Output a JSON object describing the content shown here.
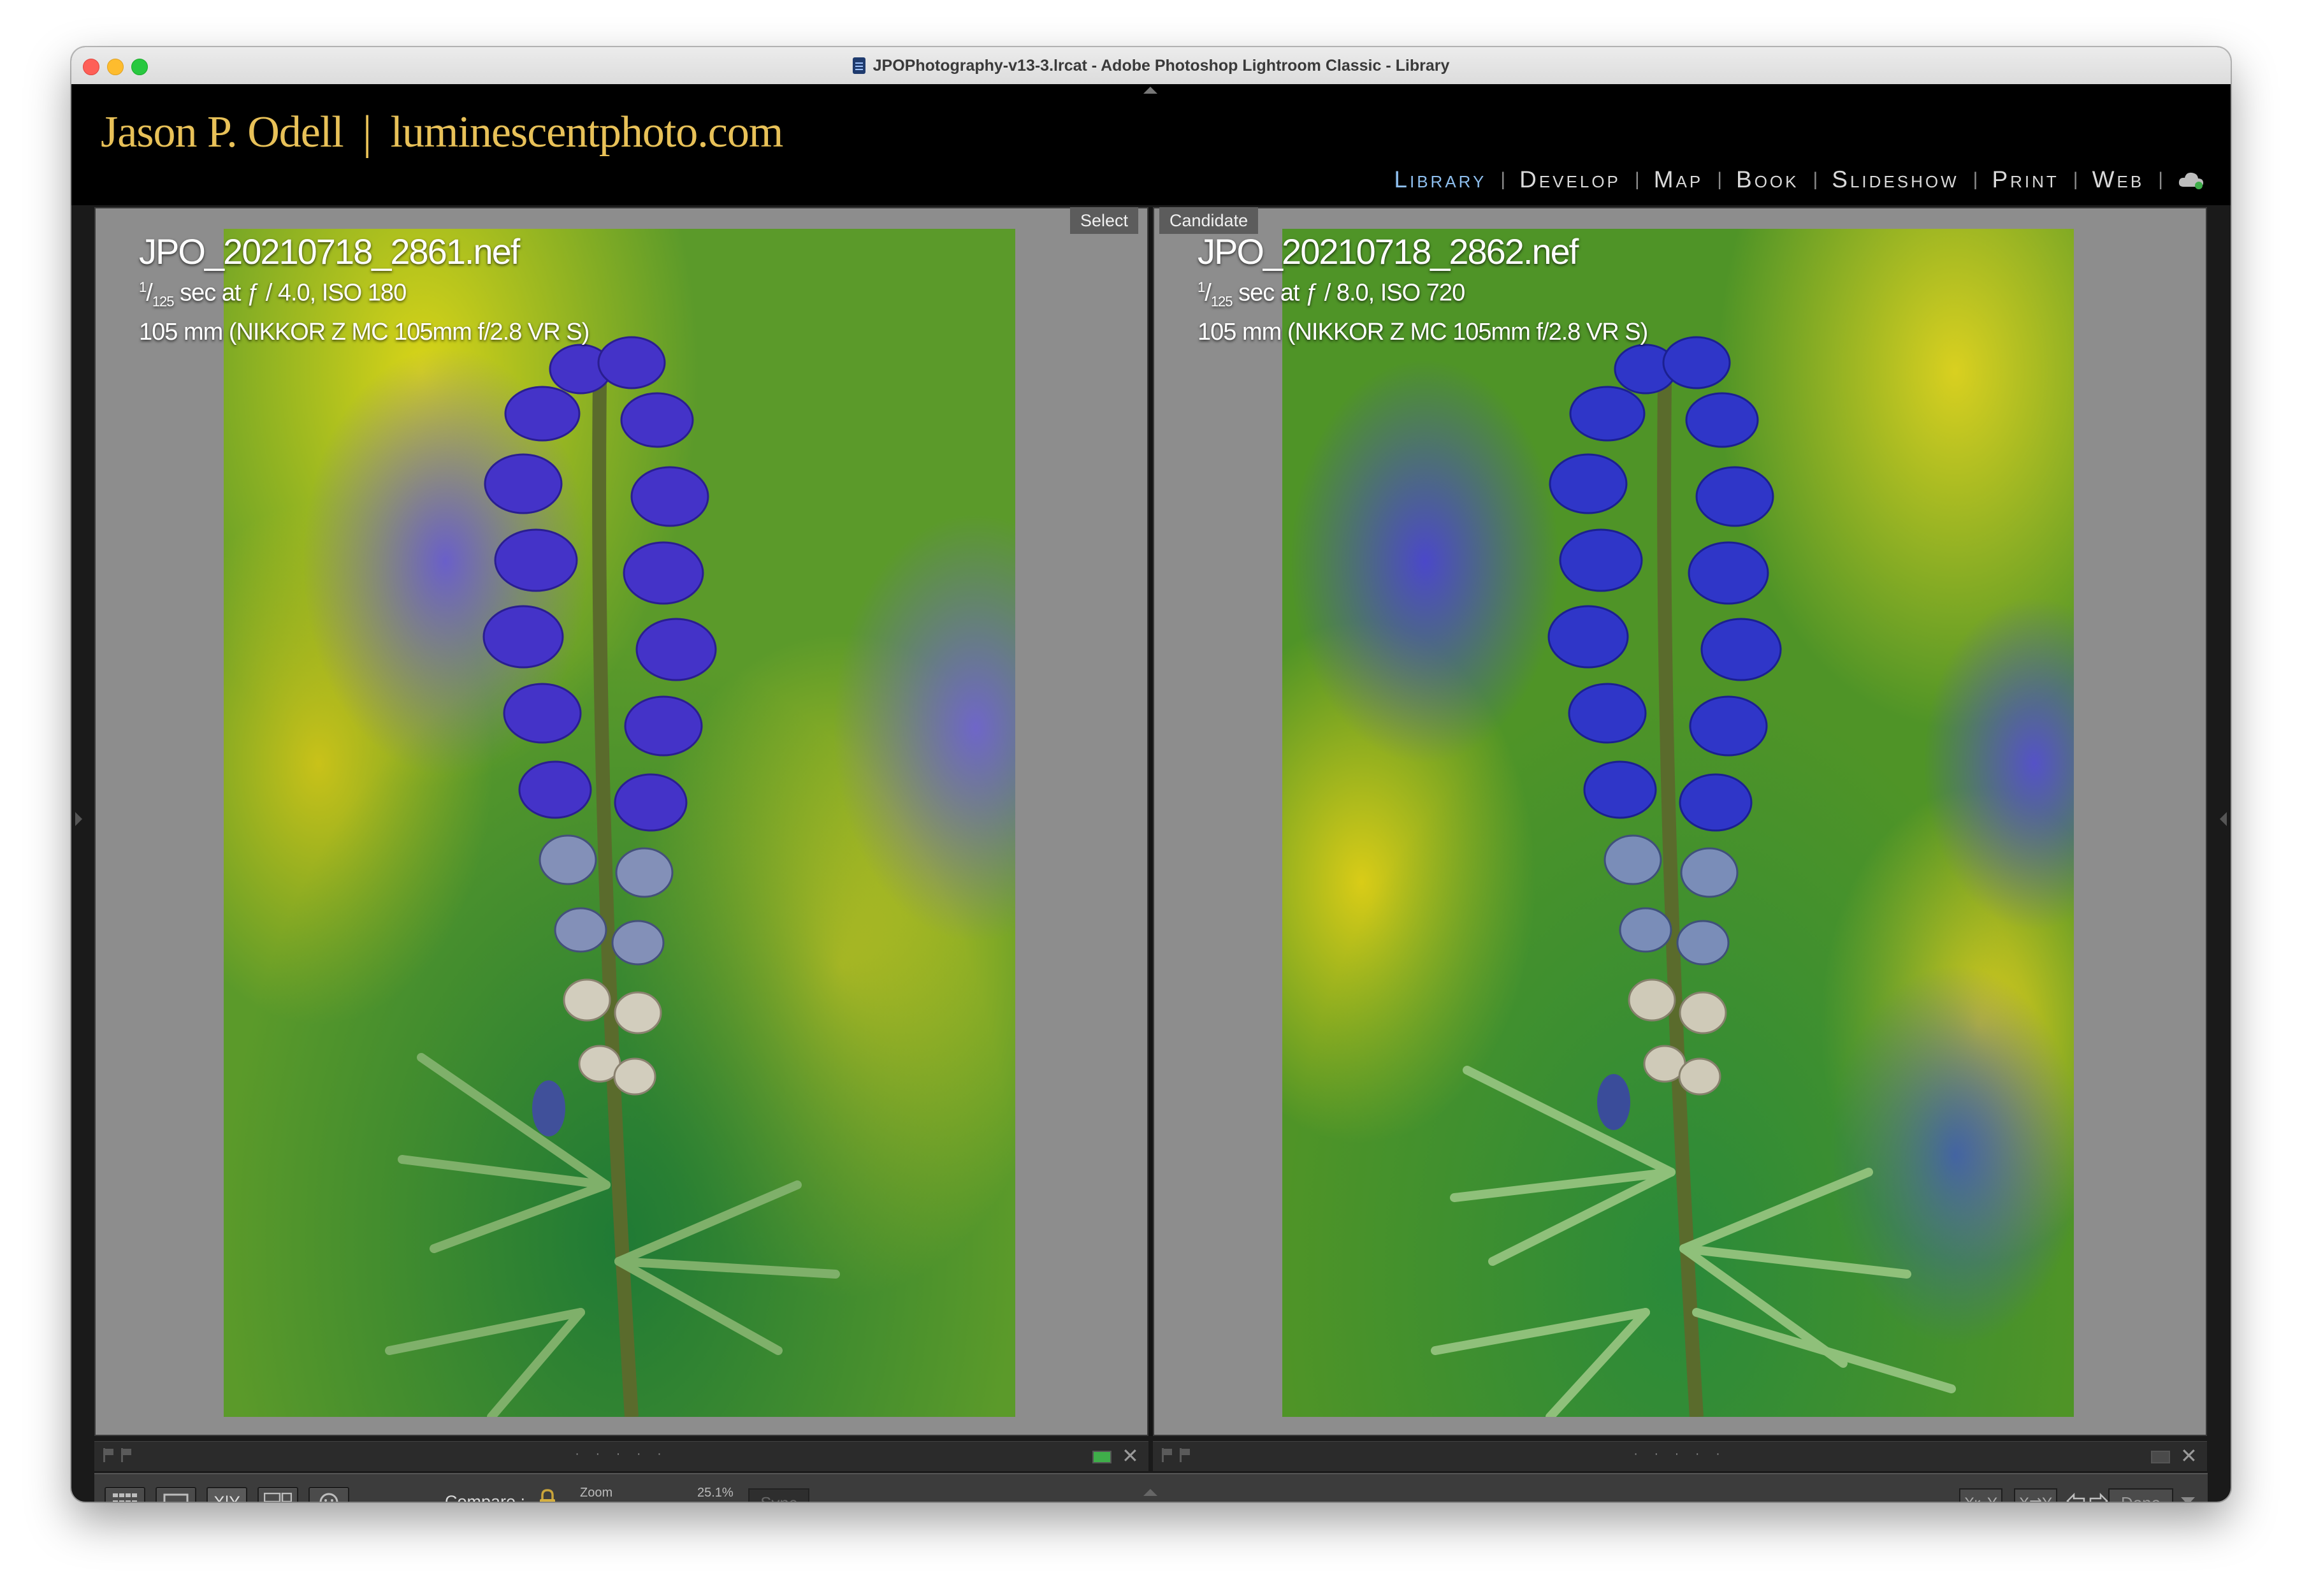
{
  "window": {
    "title": "JPOPhotography-v13-3.lrcat - Adobe Photoshop Lightroom Classic - Library"
  },
  "identity_plate": {
    "name": "Jason P. Odell",
    "separator": "|",
    "website": "luminescentphoto.com"
  },
  "modules": [
    {
      "label": "Library",
      "active": true
    },
    {
      "label": "Develop",
      "active": false
    },
    {
      "label": "Map",
      "active": false
    },
    {
      "label": "Book",
      "active": false
    },
    {
      "label": "Slideshow",
      "active": false
    },
    {
      "label": "Print",
      "active": false
    },
    {
      "label": "Web",
      "active": false
    }
  ],
  "module_separator": "|",
  "compare": {
    "select": {
      "tag": "Select",
      "filename": "JPO_20210718_2861.nef",
      "shutter_num": "1",
      "shutter_den": "125",
      "exposure_rest": "sec at ƒ / 4.0, ISO 180",
      "lens": "105 mm (NIKKOR Z MC 105mm f/2.8 VR S)"
    },
    "candidate": {
      "tag": "Candidate",
      "filename": "JPO_20210718_2862.nef",
      "shutter_num": "1",
      "shutter_den": "125",
      "exposure_rest": "sec at ƒ / 8.0, ISO 720",
      "lens": "105 mm (NIKKOR Z MC 105mm f/2.8 VR S)"
    }
  },
  "pane_footer": {
    "dots": "· · · · ·",
    "close": "✕"
  },
  "toolbar": {
    "compare_label": "Compare :",
    "zoom_label": "Zoom",
    "zoom_value": "25.1%",
    "zoom_level": 0.08,
    "sync_label": "Sync",
    "xy_label": "X|Y",
    "swap_label": "X⇄Y",
    "make_select_label": "X⇤Y",
    "done_label": "Done"
  },
  "colors": {
    "identity": "#e8c158",
    "active_module": "#8ebfef",
    "lupine": "#4a3ad0"
  },
  "icons": [
    "grid-icon",
    "loupe-icon",
    "compare-icon",
    "survey-icon",
    "people-icon",
    "lock-icon",
    "left-arrow-icon",
    "right-arrow-icon",
    "cloud-sync-icon",
    "flag-icon"
  ]
}
